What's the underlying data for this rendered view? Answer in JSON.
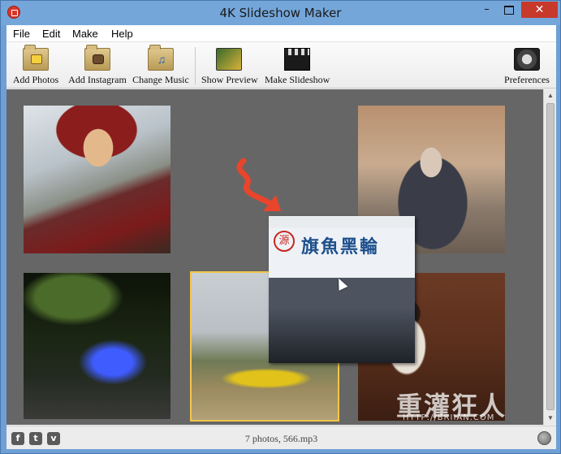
{
  "window": {
    "title": "4K Slideshow Maker",
    "controls": {
      "minimize": "–",
      "close": "✕"
    }
  },
  "menu": {
    "items": [
      "File",
      "Edit",
      "Make",
      "Help"
    ]
  },
  "toolbar": {
    "add_photos": "Add Photos",
    "add_instagram": "Add Instagram",
    "change_music": "Change Music",
    "show_preview": "Show Preview",
    "make_slideshow": "Make Slideshow",
    "preferences": "Preferences"
  },
  "canvas": {
    "market_sign": "旗魚黑輪",
    "market_sign_mark": "源",
    "watermark": "重灌狂人",
    "watermark_url": "HTTP://BRIIAN.COM"
  },
  "statusbar": {
    "social": [
      "f",
      "t",
      "v"
    ],
    "status": "7 photos, 566.mp3"
  },
  "colors": {
    "accent_arrow": "#e8452c",
    "selection": "#f2c649",
    "titlebar": "#74a6da"
  }
}
